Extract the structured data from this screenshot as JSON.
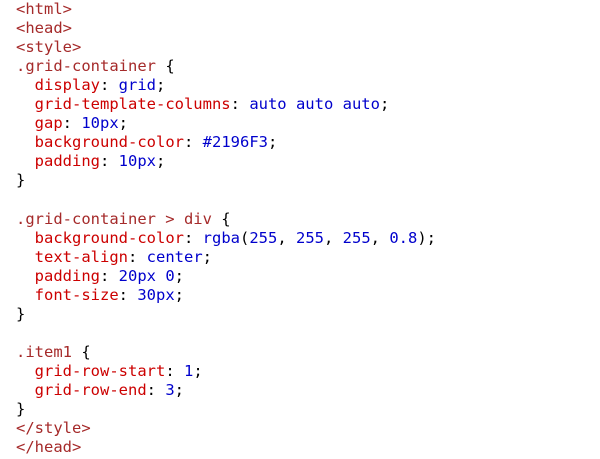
{
  "editor": {
    "lines": [
      [
        {
          "t": "tag",
          "v": "<html>"
        }
      ],
      [
        {
          "t": "tag",
          "v": "<head>"
        }
      ],
      [
        {
          "t": "tag",
          "v": "<style>"
        }
      ],
      [
        {
          "t": "sel",
          "v": ".grid-container"
        },
        {
          "t": "punct",
          "v": " {"
        }
      ],
      [
        {
          "t": "punct",
          "v": "  "
        },
        {
          "t": "prop",
          "v": "display"
        },
        {
          "t": "punct",
          "v": ": "
        },
        {
          "t": "val",
          "v": "grid"
        },
        {
          "t": "punct",
          "v": ";"
        }
      ],
      [
        {
          "t": "punct",
          "v": "  "
        },
        {
          "t": "prop",
          "v": "grid-template-columns"
        },
        {
          "t": "punct",
          "v": ": "
        },
        {
          "t": "val",
          "v": "auto auto auto"
        },
        {
          "t": "punct",
          "v": ";"
        }
      ],
      [
        {
          "t": "punct",
          "v": "  "
        },
        {
          "t": "prop",
          "v": "gap"
        },
        {
          "t": "punct",
          "v": ": "
        },
        {
          "t": "val",
          "v": "10px"
        },
        {
          "t": "punct",
          "v": ";"
        }
      ],
      [
        {
          "t": "punct",
          "v": "  "
        },
        {
          "t": "prop",
          "v": "background-color"
        },
        {
          "t": "punct",
          "v": ": "
        },
        {
          "t": "val",
          "v": "#2196F3"
        },
        {
          "t": "punct",
          "v": ";"
        }
      ],
      [
        {
          "t": "punct",
          "v": "  "
        },
        {
          "t": "prop",
          "v": "padding"
        },
        {
          "t": "punct",
          "v": ": "
        },
        {
          "t": "val",
          "v": "10px"
        },
        {
          "t": "punct",
          "v": ";"
        }
      ],
      [
        {
          "t": "punct",
          "v": "}"
        }
      ],
      [],
      [
        {
          "t": "sel",
          "v": ".grid-container > div"
        },
        {
          "t": "punct",
          "v": " {"
        }
      ],
      [
        {
          "t": "punct",
          "v": "  "
        },
        {
          "t": "prop",
          "v": "background-color"
        },
        {
          "t": "punct",
          "v": ": "
        },
        {
          "t": "val",
          "v": "rgba"
        },
        {
          "t": "punct",
          "v": "("
        },
        {
          "t": "val",
          "v": "255"
        },
        {
          "t": "punct",
          "v": ", "
        },
        {
          "t": "val",
          "v": "255"
        },
        {
          "t": "punct",
          "v": ", "
        },
        {
          "t": "val",
          "v": "255"
        },
        {
          "t": "punct",
          "v": ", "
        },
        {
          "t": "val",
          "v": "0.8"
        },
        {
          "t": "punct",
          "v": ");"
        }
      ],
      [
        {
          "t": "punct",
          "v": "  "
        },
        {
          "t": "prop",
          "v": "text-align"
        },
        {
          "t": "punct",
          "v": ": "
        },
        {
          "t": "val",
          "v": "center"
        },
        {
          "t": "punct",
          "v": ";"
        }
      ],
      [
        {
          "t": "punct",
          "v": "  "
        },
        {
          "t": "prop",
          "v": "padding"
        },
        {
          "t": "punct",
          "v": ": "
        },
        {
          "t": "val",
          "v": "20px 0"
        },
        {
          "t": "punct",
          "v": ";"
        }
      ],
      [
        {
          "t": "punct",
          "v": "  "
        },
        {
          "t": "prop",
          "v": "font-size"
        },
        {
          "t": "punct",
          "v": ": "
        },
        {
          "t": "val",
          "v": "30px"
        },
        {
          "t": "punct",
          "v": ";"
        }
      ],
      [
        {
          "t": "punct",
          "v": "}"
        }
      ],
      [],
      [
        {
          "t": "sel",
          "v": ".item1"
        },
        {
          "t": "punct",
          "v": " {"
        }
      ],
      [
        {
          "t": "punct",
          "v": "  "
        },
        {
          "t": "prop",
          "v": "grid-row-start"
        },
        {
          "t": "punct",
          "v": ": "
        },
        {
          "t": "val",
          "v": "1"
        },
        {
          "t": "punct",
          "v": ";"
        }
      ],
      [
        {
          "t": "punct",
          "v": "  "
        },
        {
          "t": "prop",
          "v": "grid-row-end"
        },
        {
          "t": "punct",
          "v": ": "
        },
        {
          "t": "val",
          "v": "3"
        },
        {
          "t": "punct",
          "v": ";"
        }
      ],
      [
        {
          "t": "punct",
          "v": "}"
        }
      ],
      [
        {
          "t": "tag",
          "v": "</style>"
        }
      ],
      [
        {
          "t": "tag",
          "v": "</head>"
        }
      ]
    ]
  }
}
